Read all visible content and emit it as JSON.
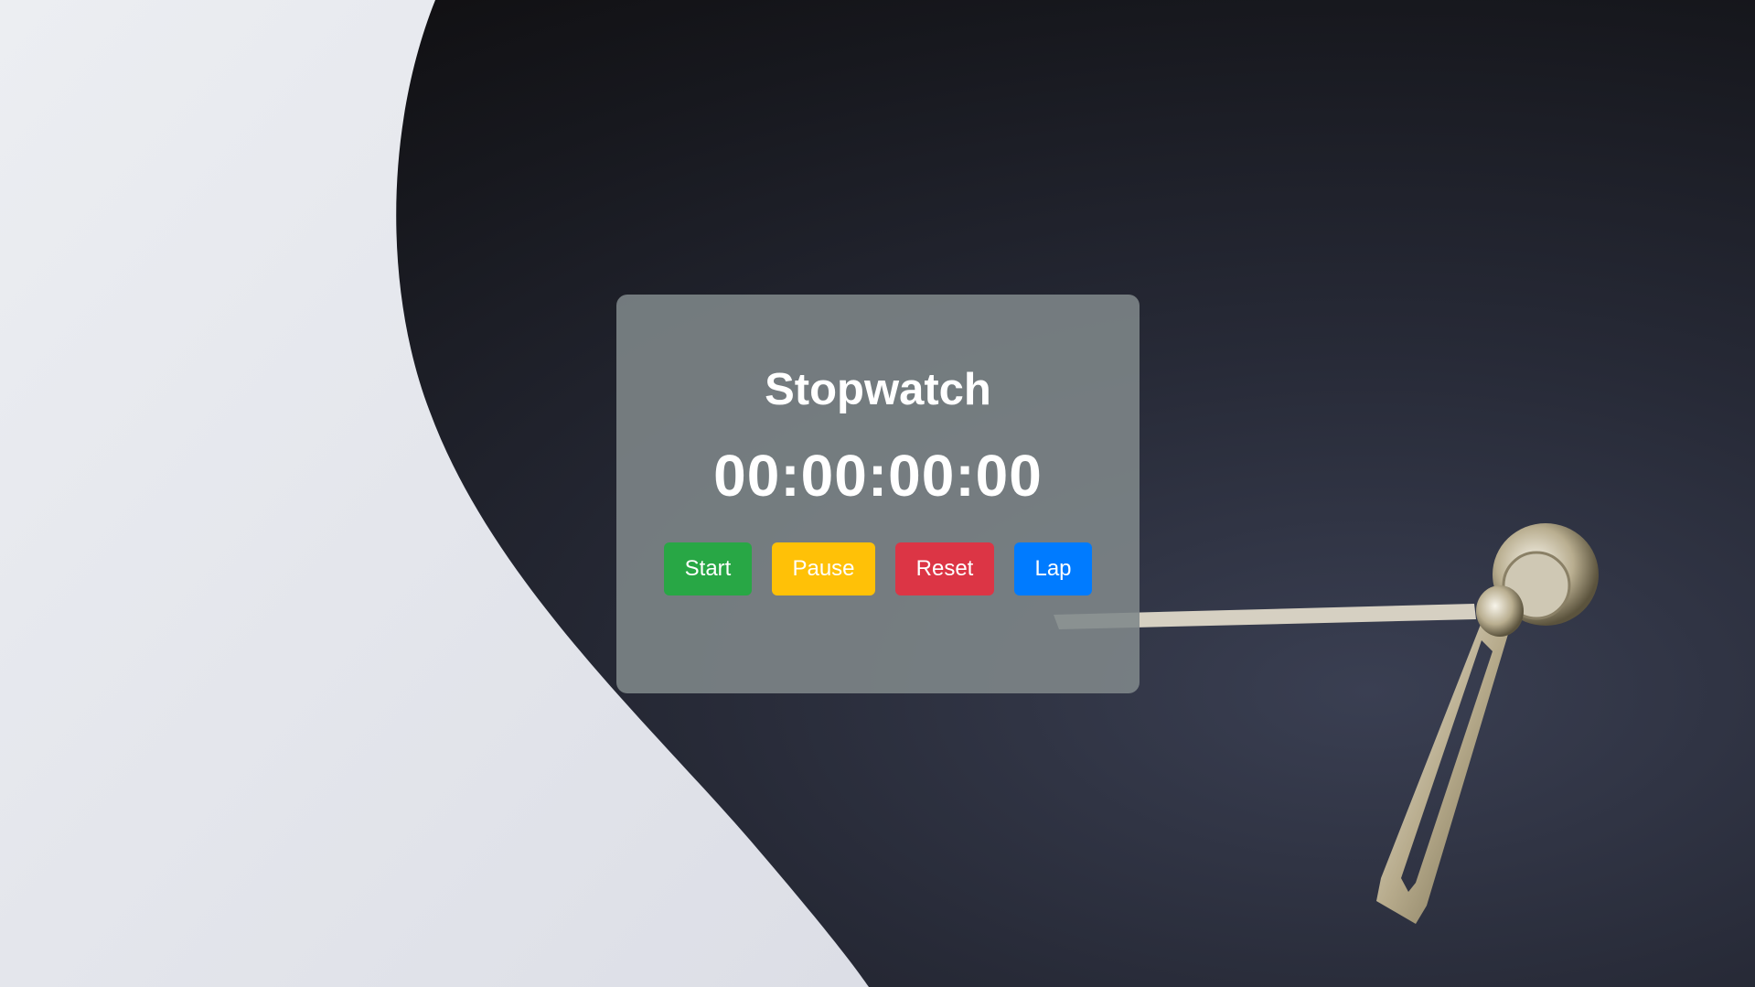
{
  "stopwatch": {
    "title": "Stopwatch",
    "time": "00:00:00:00",
    "buttons": {
      "start": "Start",
      "pause": "Pause",
      "reset": "Reset",
      "lap": "Lap"
    }
  },
  "colors": {
    "start": "#28a745",
    "pause": "#ffc107",
    "reset": "#dc3545",
    "lap": "#007bff"
  }
}
